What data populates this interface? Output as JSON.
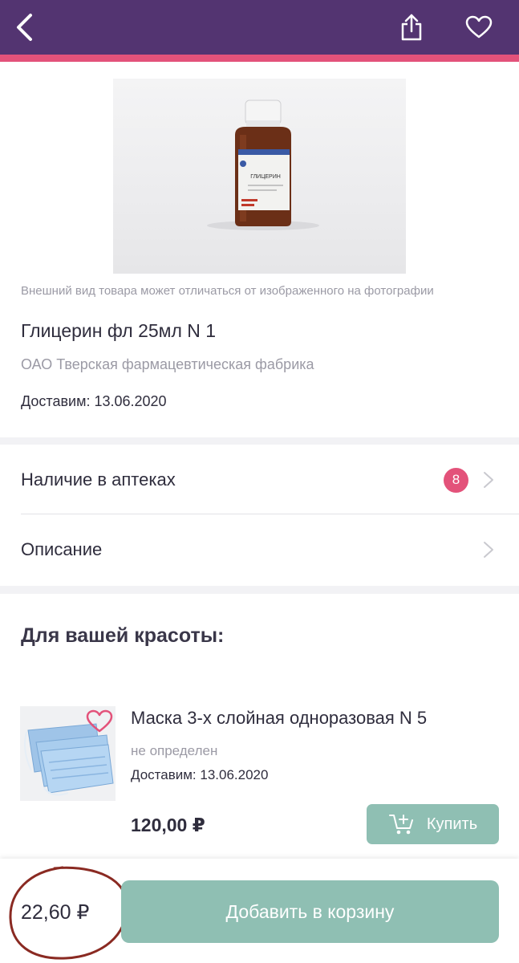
{
  "header": {
    "back_icon": "chevron-left-icon",
    "share_icon": "share-icon",
    "favorite_icon": "heart-outline-icon",
    "bg_color": "#533471",
    "accent_color": "#e3527a"
  },
  "product": {
    "image_label": "ГЛИЦЕРИН",
    "disclaimer": "Внешний вид товара может отличаться от изображенного на фотографии",
    "title": "Глицерин фл 25мл N 1",
    "manufacturer": "ОАО Тверская фармацевтическая фабрика",
    "delivery_label": "Доставим:",
    "delivery_date": "13.06.2020"
  },
  "rows": {
    "availability": {
      "label": "Наличие в аптеках",
      "count": "8"
    },
    "description": {
      "label": "Описание"
    }
  },
  "recommendations": {
    "title": "Для вашей красоты:",
    "items": [
      {
        "title": "Маска 3-х слойная одноразовая N 5",
        "manufacturer": "не определен",
        "delivery": "Доставим: 13.06.2020",
        "price": "120,00 ₽",
        "buy_label": "Купить"
      }
    ]
  },
  "footer": {
    "price": "22,60 ₽",
    "add_to_cart_label": "Добавить в корзину",
    "button_color": "#8fbfb3"
  }
}
